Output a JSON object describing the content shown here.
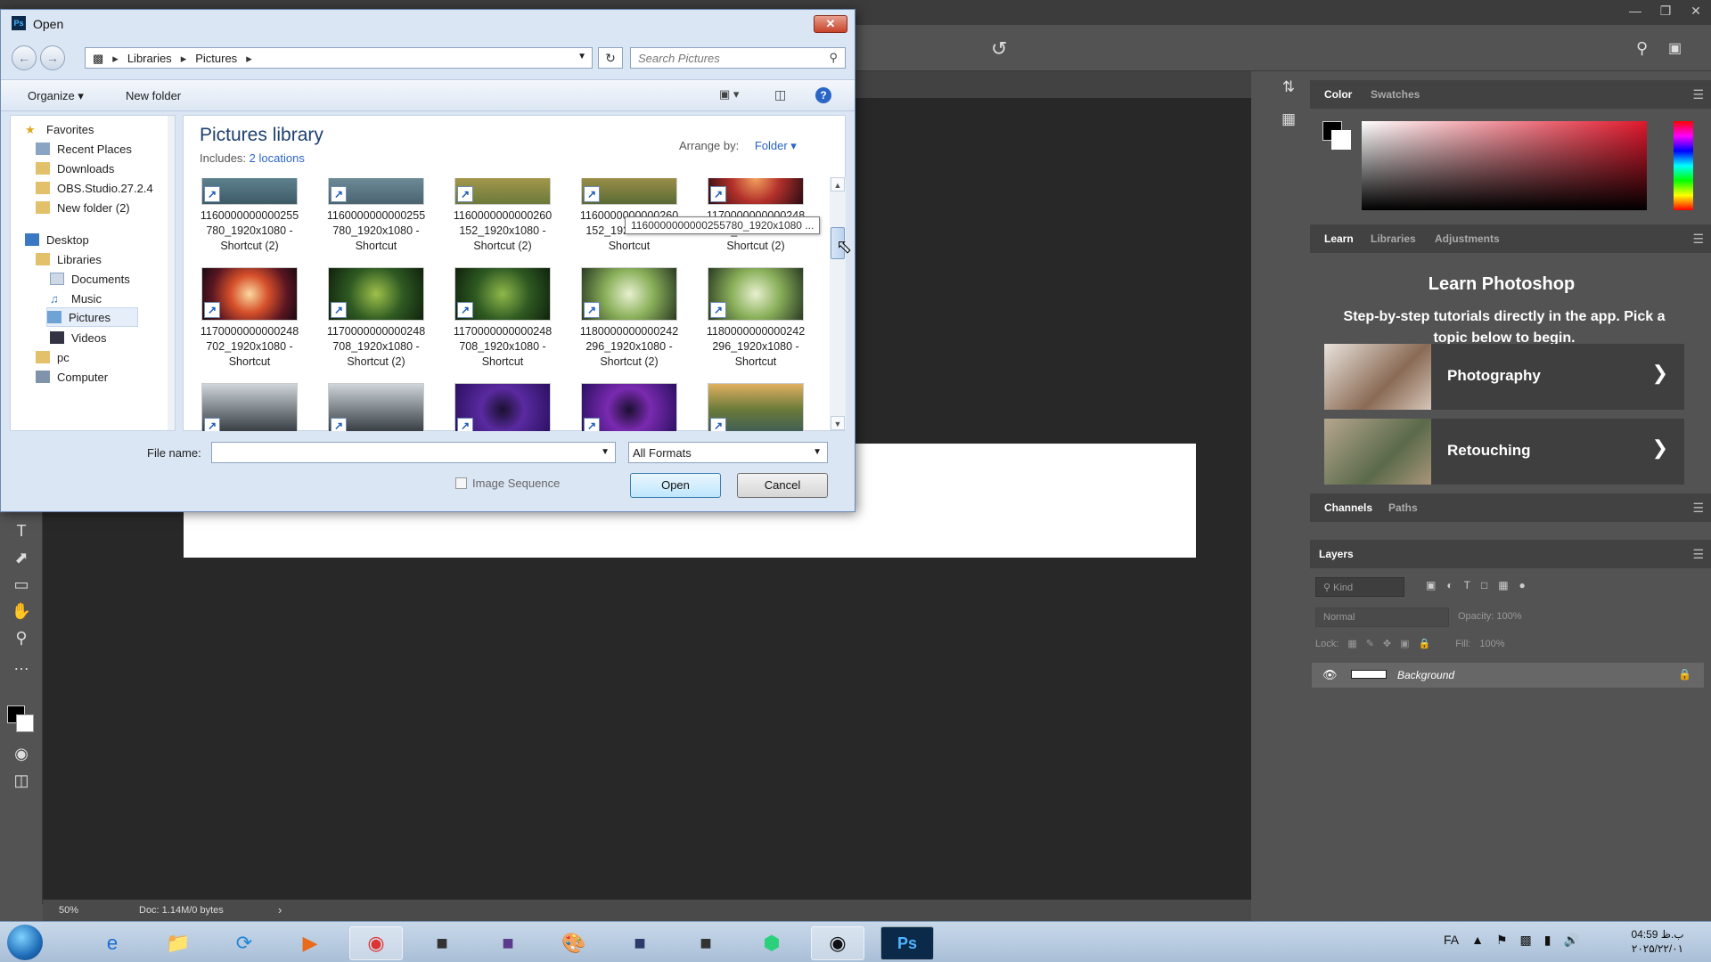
{
  "photoshop": {
    "status": {
      "zoom": "50%",
      "doc": "Doc: 1.14M/0 bytes"
    },
    "color_panel": {
      "tabs": [
        "Color",
        "Swatches"
      ]
    },
    "learn_panel": {
      "tabs": [
        "Learn",
        "Libraries",
        "Adjustments"
      ],
      "title": "Learn Photoshop",
      "subtitle": "Step-by-step tutorials directly in the app. Pick a topic below to begin.",
      "cards": [
        "Photography",
        "Retouching"
      ]
    },
    "channels_panel": {
      "tabs": [
        "Channels",
        "Paths"
      ]
    },
    "layers_panel": {
      "title": "Layers",
      "filter_placeholder": "Kind",
      "blend_mode": "Normal",
      "opacity_label": "Opacity:",
      "opacity_value": "100%",
      "lock_label": "Lock:",
      "fill_label": "Fill:",
      "fill_value": "100%",
      "layer_name": "Background"
    }
  },
  "dialog": {
    "title": "Open",
    "address": [
      "Libraries",
      "Pictures"
    ],
    "search_placeholder": "Search Pictures",
    "organize": "Organize",
    "new_folder": "New folder",
    "nav_items": [
      "Favorites",
      "Recent Places",
      "Downloads",
      "OBS.Studio.27.2.4",
      "New folder (2)",
      "Desktop",
      "Libraries",
      "Documents",
      "Music",
      "Pictures",
      "Videos",
      "pc",
      "Computer"
    ],
    "library_title": "Pictures library",
    "includes_label": "Includes:",
    "includes_link": "2 locations",
    "arrange_label": "Arrange by:",
    "arrange_value": "Folder",
    "files": [
      {
        "l1": "1160000000000255",
        "l2": "780_1920x1080 -",
        "l3": "Shortcut (2)"
      },
      {
        "l1": "1160000000000255",
        "l2": "780_1920x1080 -",
        "l3": "Shortcut"
      },
      {
        "l1": "1160000000000260",
        "l2": "152_1920x1080 -",
        "l3": "Shortcut (2)"
      },
      {
        "l1": "1160000000000260",
        "l2": "152_1920x1080 -",
        "l3": "Shortcut"
      },
      {
        "l1": "1170000000000248",
        "l2": "702_1920x1080 -",
        "l3": "Shortcut (2)"
      },
      {
        "l1": "1170000000000248",
        "l2": "702_1920x1080 -",
        "l3": "Shortcut"
      },
      {
        "l1": "1170000000000248",
        "l2": "708_1920x1080 -",
        "l3": "Shortcut (2)"
      },
      {
        "l1": "1170000000000248",
        "l2": "708_1920x1080 -",
        "l3": "Shortcut"
      },
      {
        "l1": "1180000000000242",
        "l2": "296_1920x1080 -",
        "l3": "Shortcut (2)"
      },
      {
        "l1": "1180000000000242",
        "l2": "296_1920x1080 -",
        "l3": "Shortcut"
      },
      {
        "l1": "",
        "l2": "",
        "l3": ""
      },
      {
        "l1": "",
        "l2": "",
        "l3": ""
      },
      {
        "l1": "",
        "l2": "",
        "l3": ""
      },
      {
        "l1": "",
        "l2": "",
        "l3": ""
      },
      {
        "l1": "",
        "l2": "",
        "l3": ""
      }
    ],
    "tooltip": "1160000000000255780_1920x1080 ...",
    "file_name_label": "File name:",
    "file_name_value": "",
    "format": "All Formats",
    "image_sequence": "Image Sequence",
    "open_button": "Open",
    "cancel_button": "Cancel"
  },
  "taskbar": {
    "language": "FA",
    "time": "04:59 ب.ظ",
    "date": "۲۰۲۵/۲۲/۰۱"
  }
}
